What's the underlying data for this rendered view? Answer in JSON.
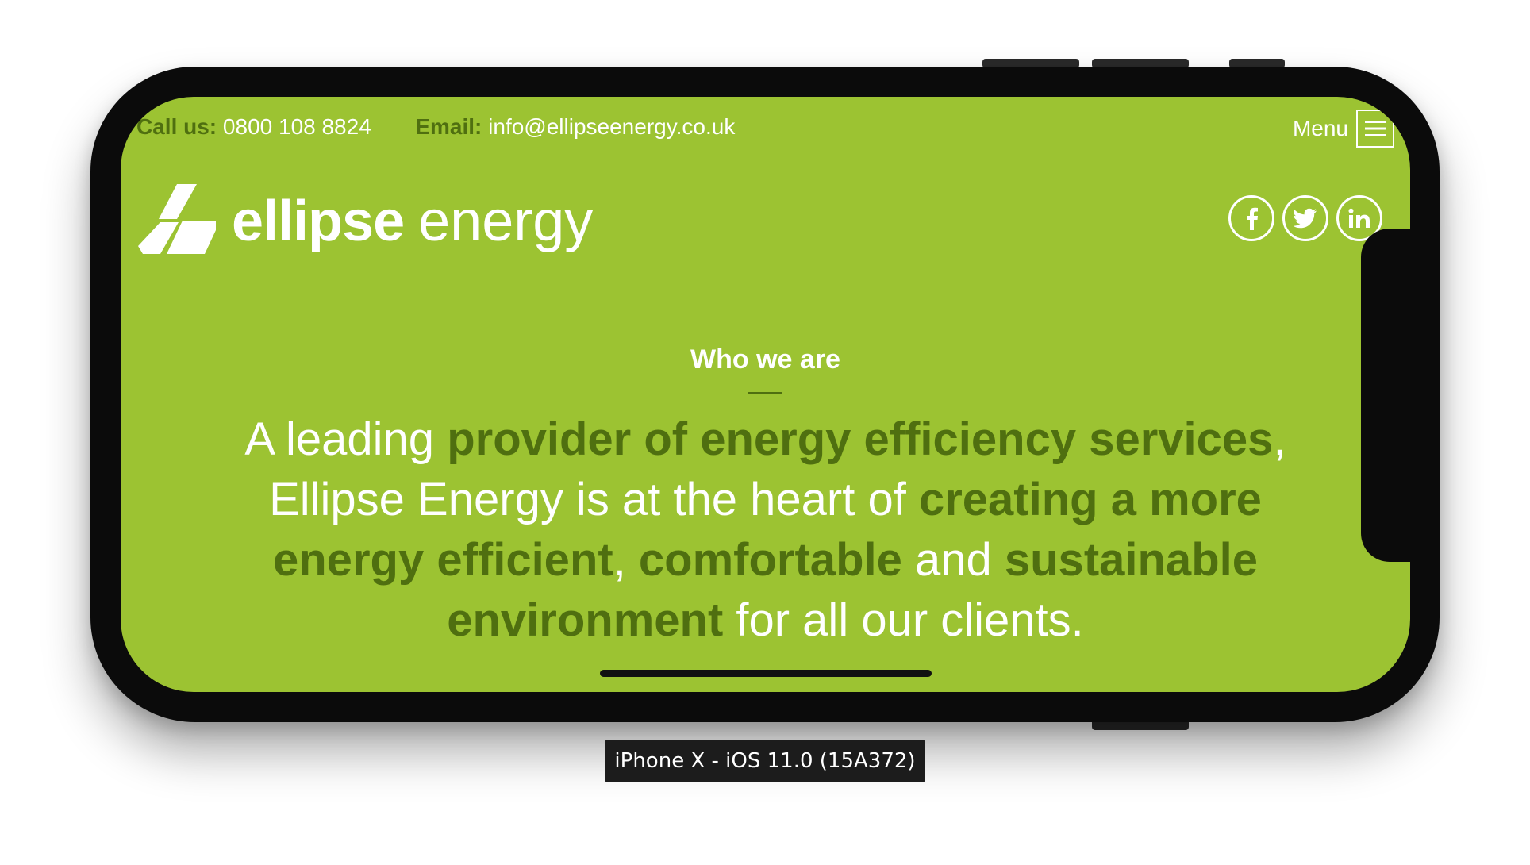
{
  "device_label": "iPhone X - iOS 11.0 (15A372)",
  "topbar": {
    "call_label": "Call us:",
    "phone": "0800 108 8824",
    "email_label": "Email:",
    "email": "info@ellipseenergy.co.uk",
    "menu_label": "Menu"
  },
  "logo": {
    "word_bold": "ellipse",
    "word_light": "energy"
  },
  "social": [
    "facebook-icon",
    "twitter-icon",
    "linkedin-icon"
  ],
  "hero": {
    "kicker": "Who we are",
    "parts": [
      "A leading ",
      "provider of energy efficiency services",
      ", Ellipse Energy is at the heart of ",
      "creating a more energy efficient",
      ", ",
      "comfortable",
      " and ",
      "sustainable environment",
      " for all our clients."
    ]
  },
  "colors": {
    "background": "#9cc332",
    "accent_dark": "#4f6f10",
    "text_light": "#ffffff"
  }
}
